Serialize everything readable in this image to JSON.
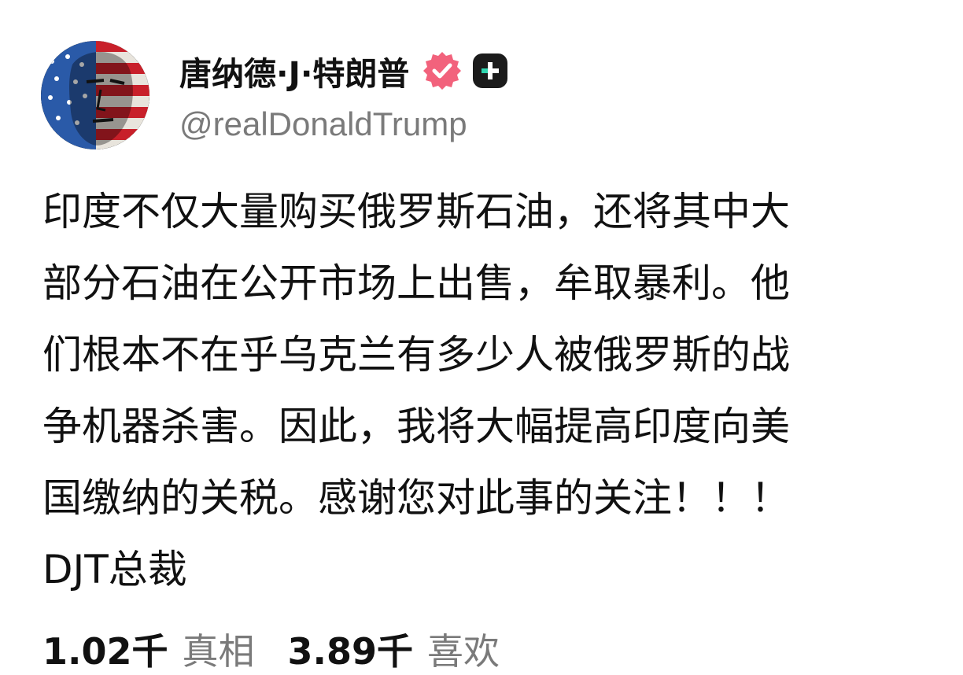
{
  "post": {
    "author": {
      "display_name": "唐纳德·J·特朗普",
      "handle": "@realDonaldTrump",
      "verified_icon": "verified-badge-icon",
      "plus_icon": "plus-badge-icon",
      "badge_color": "#f2627c"
    },
    "body_lines": [
      "印度不仅大量购买俄罗斯石油，还将其中大",
      "部分石油在公开市场上出售，牟取暴利。他",
      "们根本不在乎乌克兰有多少人被俄罗斯的战",
      "争机器杀害。因此，我将大幅提高印度向美",
      "国缴纳的关税。感谢您对此事的关注！！！",
      "DJT总裁"
    ],
    "stats": {
      "truths_count": "1.02千",
      "truths_label": "真相",
      "likes_count": "3.89千",
      "likes_label": "喜欢"
    }
  }
}
